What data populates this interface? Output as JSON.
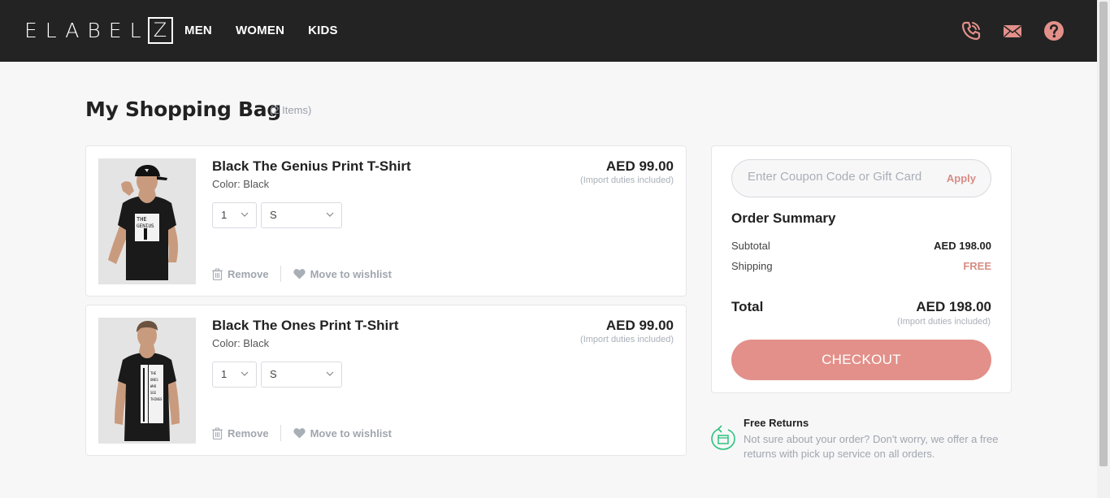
{
  "header": {
    "logo_letters": "ELABEL",
    "logo_boxed": "Z",
    "nav": [
      "MEN",
      "WOMEN",
      "KIDS"
    ],
    "icons": [
      "phone-icon",
      "mail-icon",
      "help-icon"
    ]
  },
  "page": {
    "title": "My Shopping Bag",
    "count": "(2 Items)"
  },
  "items": [
    {
      "name": "Black The Genius Print T-Shirt",
      "color": "Color: Black",
      "price": "AED 99.00",
      "duties": "(Import duties included)",
      "qty": "1",
      "size": "S",
      "remove": "Remove",
      "wishlist": "Move to wishlist",
      "print_text": "THE GENIUS"
    },
    {
      "name": "Black The Ones Print T-Shirt",
      "color": "Color: Black",
      "price": "AED 99.00",
      "duties": "(Import duties included)",
      "qty": "1",
      "size": "S",
      "remove": "Remove",
      "wishlist": "Move to wishlist",
      "print_text": "THE ONES"
    }
  ],
  "summary": {
    "coupon_placeholder": "Enter Coupon Code or Gift Card",
    "apply": "Apply",
    "title": "Order Summary",
    "subtotal_label": "Subtotal",
    "subtotal_value": "AED 198.00",
    "shipping_label": "Shipping",
    "shipping_value": "FREE",
    "total_label": "Total",
    "total_value": "AED 198.00",
    "duties": "(Import duties included)",
    "checkout": "CHECKOUT"
  },
  "returns": {
    "title": "Free Returns",
    "text": "Not sure about your order? Don't worry, we offer a free returns with pick up service on all orders."
  },
  "colors": {
    "header_bg": "#232323",
    "accent": "#e3908a",
    "accent_text": "#d78c85",
    "returns_icon": "#2ec27e"
  }
}
